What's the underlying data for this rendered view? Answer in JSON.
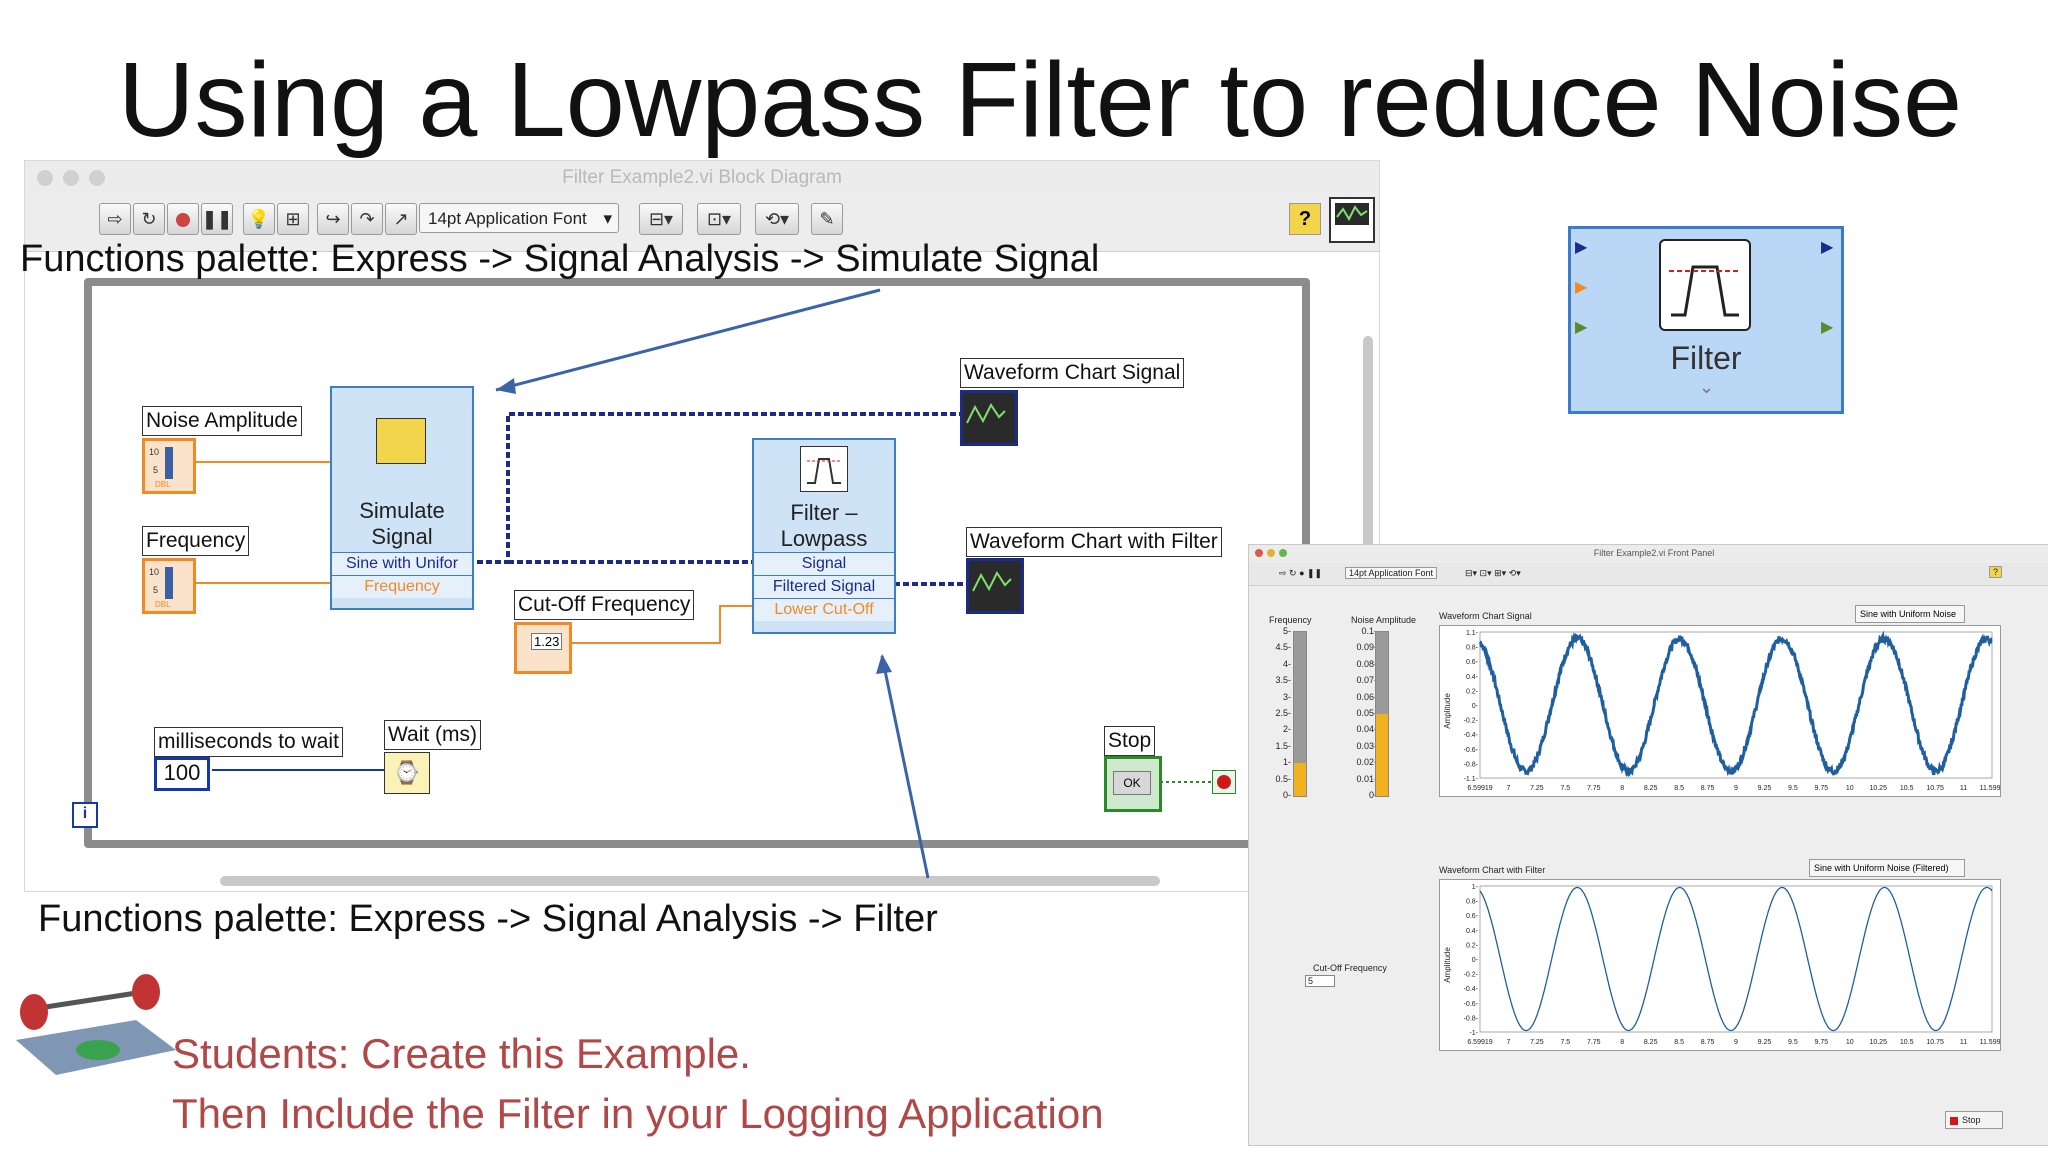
{
  "slide": {
    "title": "Using a Lowpass Filter to reduce Noise",
    "caption_top": "Functions  palette: Express -> Signal Analysis -> Simulate Signal",
    "caption_bottom": "Functions  palette: Express -> Signal Analysis -> Filter",
    "students_line1": "Students:  Create this Example.",
    "students_line2": "Then Include the Filter in your Logging  Application"
  },
  "block_diagram": {
    "window_title": "Filter Example2.vi Block Diagram",
    "toolbar": {
      "font": "14pt Application Font",
      "help_label": "?"
    },
    "labels": {
      "noise_amplitude": "Noise Amplitude",
      "frequency": "Frequency",
      "cutoff_frequency": "Cut-Off Frequency",
      "ms_to_wait": "milliseconds to wait",
      "ms_value": "100",
      "wait": "Wait (ms)",
      "stop": "Stop",
      "stop_ok": "OK",
      "chart_signal": "Waveform Chart  Signal",
      "chart_filter": "Waveform Chart  with Filter",
      "cutoff_numeric": "1.23",
      "loop_iter": "i"
    },
    "simulate_signal": {
      "title_line1": "Simulate",
      "title_line2": "Signal",
      "term1": "Sine with Unifor",
      "term2": "Frequency"
    },
    "filter_node": {
      "title_line1": "Filter –",
      "title_line2": "Lowpass",
      "term1": "Signal",
      "term2": "Filtered Signal",
      "term3": "Lower Cut-Off"
    }
  },
  "filter_icon": {
    "label": "Filter"
  },
  "front_panel": {
    "window_title": "Filter Example2.vi Front Panel",
    "toolbar_font": "14pt Application Font",
    "frequency_label": "Frequency",
    "frequency_ticks": [
      "5-",
      "4.5-",
      "4-",
      "3.5-",
      "3-",
      "2.5-",
      "2-",
      "1.5-",
      "1-",
      "0.5-",
      "0-"
    ],
    "frequency_value_fraction": 0.2,
    "noise_label": "Noise Amplitude",
    "noise_ticks": [
      "0.1-",
      "0.09-",
      "0.08-",
      "0.07-",
      "0.06-",
      "0.05-",
      "0.04-",
      "0.03-",
      "0.02-",
      "0.01-",
      "0-"
    ],
    "noise_value_fraction": 0.5,
    "cutoff_label": "Cut-Off Frequency",
    "cutoff_value": "5",
    "stop_label": "Stop",
    "chart1": {
      "title": "Waveform Chart  Signal",
      "legend": "Sine with Uniform Noise",
      "ylabel": "Amplitude",
      "yticks": [
        "1.1-",
        "0.8-",
        "0.6-",
        "0.4-",
        "0.2-",
        "0-",
        "-0.2-",
        "-0.4-",
        "-0.6-",
        "-0.8-",
        "-1.1-"
      ],
      "xticks": [
        "6.59919",
        "7",
        "7.25",
        "7.5",
        "7.75",
        "8",
        "8.25",
        "8.5",
        "8.75",
        "9",
        "9.25",
        "9.5",
        "9.75",
        "10",
        "10.25",
        "10.5",
        "10.75",
        "11",
        "11.5991"
      ]
    },
    "chart2": {
      "title": "Waveform Chart  with Filter",
      "legend": "Sine with Uniform Noise (Filtered)",
      "ylabel": "Amplitude",
      "yticks": [
        "1-",
        "0.8-",
        "0.6-",
        "0.4-",
        "0.2-",
        "0-",
        "-0.2-",
        "-0.4-",
        "-0.6-",
        "-0.8-",
        "-1-"
      ],
      "xticks": [
        "6.59919",
        "7",
        "7.25",
        "7.5",
        "7.75",
        "8",
        "8.25",
        "8.5",
        "8.75",
        "9",
        "9.25",
        "9.5",
        "9.75",
        "10",
        "10.25",
        "10.5",
        "10.75",
        "11",
        "11.5991"
      ]
    }
  },
  "chart_data": [
    {
      "type": "line",
      "title": "Waveform Chart  Signal",
      "ylabel": "Amplitude",
      "xlim": [
        6.59919,
        11.5991
      ],
      "ylim": [
        -1.1,
        1.1
      ],
      "series": [
        {
          "name": "Sine with Uniform Noise",
          "function": "sine",
          "frequency": 1,
          "amplitude": 1,
          "noise": 0.05
        }
      ]
    },
    {
      "type": "line",
      "title": "Waveform Chart  with Filter",
      "ylabel": "Amplitude",
      "xlim": [
        6.59919,
        11.5991
      ],
      "ylim": [
        -1,
        1
      ],
      "series": [
        {
          "name": "Sine with Uniform Noise (Filtered)",
          "function": "sine",
          "frequency": 1,
          "amplitude": 0.98,
          "noise": 0
        }
      ]
    }
  ]
}
